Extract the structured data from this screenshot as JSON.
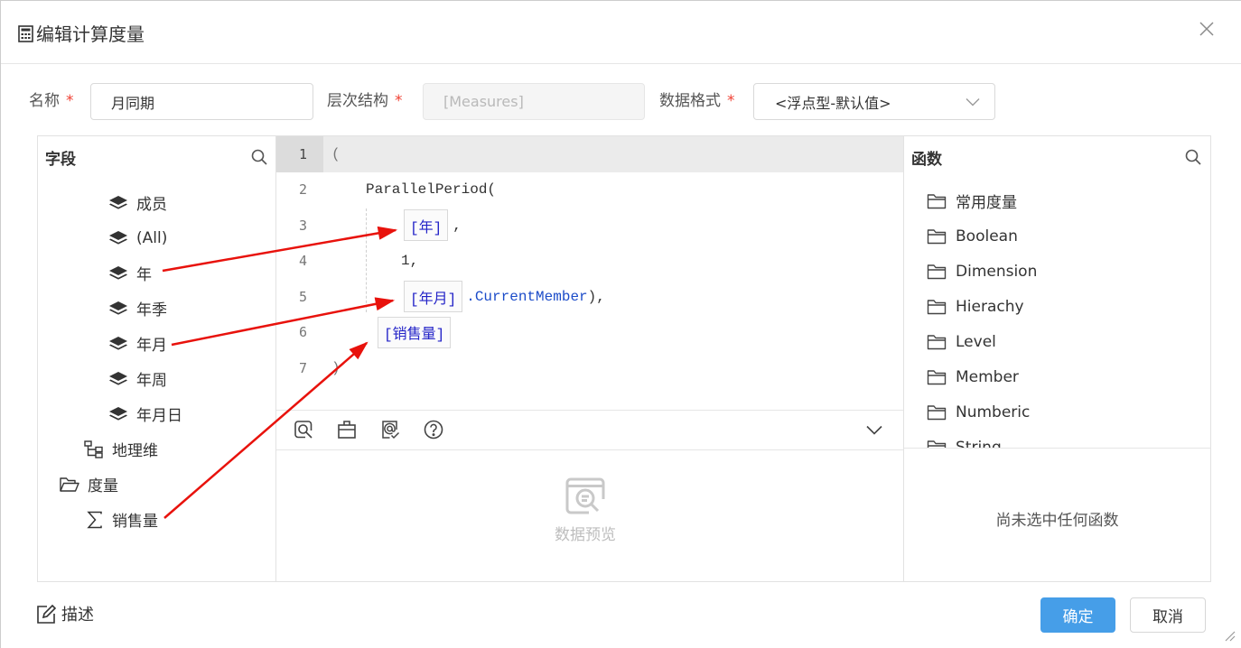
{
  "dialog": {
    "title": "编辑计算度量",
    "title_icon": "calculator-icon",
    "close_icon": "close-icon",
    "resize_icon": "resize-grip-icon"
  },
  "form": {
    "required_mark": "*",
    "name": {
      "label": "名称",
      "value": "月同期"
    },
    "hierarchy": {
      "label": "层次结构",
      "value": "[Measures]"
    },
    "format": {
      "label": "数据格式",
      "value": "<浮点型-默认值>",
      "icon": "chevron-down-icon"
    }
  },
  "fields_panel": {
    "title": "字段",
    "search_icon": "search-icon",
    "items": [
      {
        "label": "成员",
        "icon": "layers-icon"
      },
      {
        "label": "(All)",
        "icon": "layers-icon"
      },
      {
        "label": "年",
        "icon": "layers-icon"
      },
      {
        "label": "年季",
        "icon": "layers-icon"
      },
      {
        "label": "年月",
        "icon": "layers-icon"
      },
      {
        "label": "年周",
        "icon": "layers-icon"
      },
      {
        "label": "年月日",
        "icon": "layers-icon"
      },
      {
        "label": "地理维",
        "icon": "hierarchy-icon"
      },
      {
        "label": "度量",
        "icon": "folder-open-icon"
      },
      {
        "label": "销售量",
        "icon": "sigma-icon"
      }
    ]
  },
  "editor": {
    "active_line": 1,
    "lines": [
      {
        "number": "1",
        "text": "("
      },
      {
        "number": "2",
        "text": "ParallelPeriod("
      },
      {
        "number": "3",
        "ref": "[年]",
        "text": ","
      },
      {
        "number": "4",
        "text": "1,"
      },
      {
        "number": "5",
        "ref": "[年月]",
        "member": ".CurrentMember",
        "text": "),"
      },
      {
        "number": "6",
        "ref": "[销售量]"
      },
      {
        "number": "7",
        "text": ")"
      }
    ],
    "toolbar_icons": [
      "query-preview-icon",
      "clipboard-icon",
      "check-syntax-icon",
      "help-icon"
    ],
    "collapse_icon": "chevron-down-icon"
  },
  "preview": {
    "icon": "data-preview-icon",
    "label": "数据预览"
  },
  "functions_panel": {
    "title": "函数",
    "search_icon": "search-icon",
    "folder_icon": "folder-icon",
    "folders": [
      "常用度量",
      "Boolean",
      "Dimension",
      "Hierachy",
      "Level",
      "Member",
      "Numberic",
      "String"
    ],
    "empty_message": "尚未选中任何函数"
  },
  "footer": {
    "description_icon": "edit-icon",
    "description_label": "描述",
    "confirm_label": "确定",
    "cancel_label": "取消"
  },
  "colors": {
    "accent": "#469ee8",
    "required": "#f04134",
    "reference": "#2424c8",
    "member": "#1c4cc9",
    "annotation": "#e8120c",
    "active_line": "#ebebeb"
  }
}
